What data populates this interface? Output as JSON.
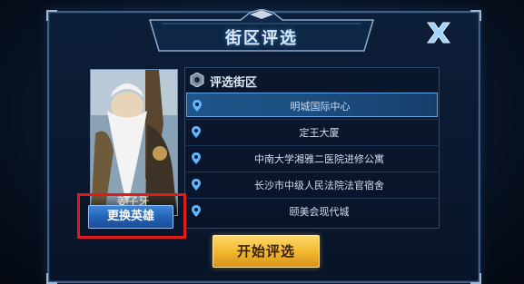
{
  "dialog": {
    "title": "街区评选",
    "close_icon": "close-x-icon"
  },
  "hero": {
    "name": "姜子牙",
    "change_button_label": "更换英雄"
  },
  "district_list": {
    "header_icon": "badge-icon",
    "header_label": "评选街区",
    "items": [
      {
        "label": "明城国际中心",
        "selected": true
      },
      {
        "label": "定王大厦",
        "selected": false
      },
      {
        "label": "中南大学湘雅二医院进修公寓",
        "selected": false
      },
      {
        "label": "长沙市中级人民法院法官宿舍",
        "selected": false
      },
      {
        "label": "颐美会现代城",
        "selected": false
      }
    ]
  },
  "start_button_label": "开始评选",
  "colors": {
    "accent_blue": "#2161b6",
    "gold": "#f3b930",
    "highlight_red": "#e01b1b"
  }
}
